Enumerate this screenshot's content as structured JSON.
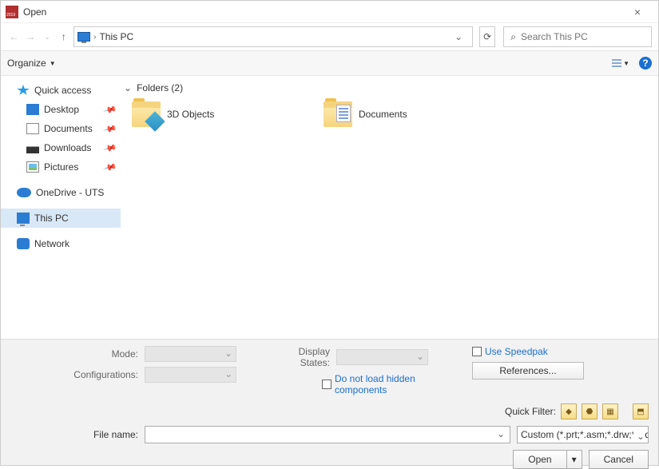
{
  "title": "Open",
  "breadcrumb": {
    "location": "This PC"
  },
  "search": {
    "placeholder": "Search This PC"
  },
  "toolbar": {
    "organize": "Organize"
  },
  "sidebar": {
    "quick_access": "Quick access",
    "desktop": "Desktop",
    "documents": "Documents",
    "downloads": "Downloads",
    "pictures": "Pictures",
    "onedrive": "OneDrive - UTS",
    "this_pc": "This PC",
    "network": "Network"
  },
  "content": {
    "group_label": "Folders (2)",
    "items": [
      {
        "label": "3D Objects"
      },
      {
        "label": "Documents"
      }
    ]
  },
  "options": {
    "mode_label": "Mode:",
    "config_label": "Configurations:",
    "display_states_label": "Display States:",
    "no_load_hidden": "Do not load hidden components",
    "use_speedpak": "Use Speedpak",
    "references": "References...",
    "quick_filter": "Quick Filter:",
    "filename_label": "File name:",
    "filter_value": "Custom (*.prt;*.asm;*.drw;*.sld",
    "open": "Open",
    "cancel": "Cancel"
  }
}
